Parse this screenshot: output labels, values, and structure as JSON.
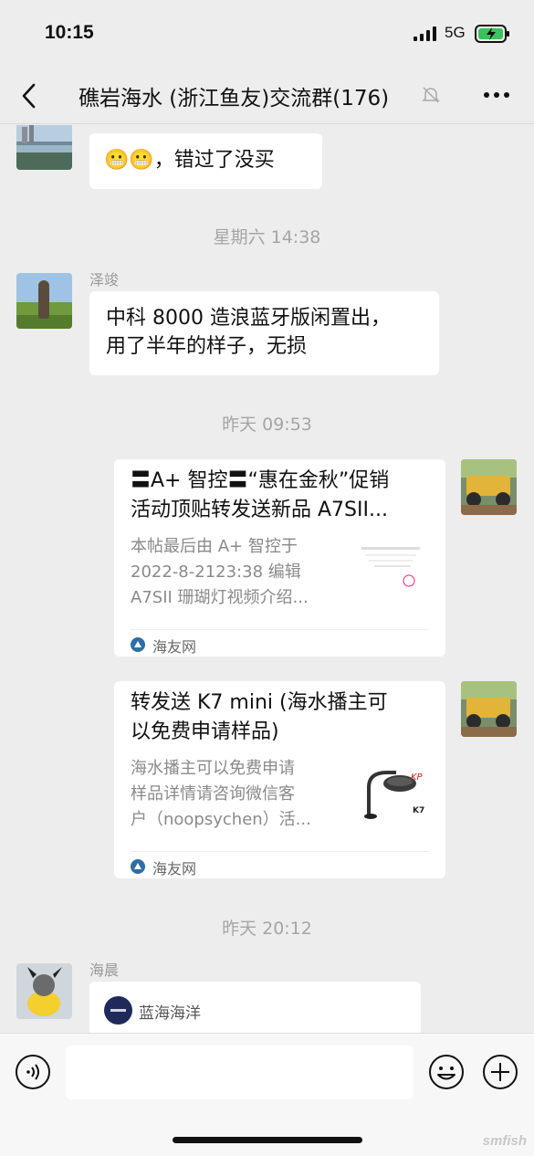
{
  "status": {
    "time": "10:15",
    "network": "5G"
  },
  "header": {
    "title": "礁岩海水 (浙江鱼友)交流群(176)"
  },
  "messages": {
    "m1": {
      "text": "😬😬，错过了没买"
    },
    "sep1": "星期六 14:38",
    "m2": {
      "sender": "泽竣",
      "line1": "中科 8000 造浪蓝牙版闲置出，",
      "line2": "用了半年的样子，无损"
    },
    "sep2": "昨天 09:53",
    "card1": {
      "title_l1": "〓A+ 智控〓“惠在金秋”促销",
      "title_l2": "活动顶贴转发送新品 A7SII...",
      "desc_l1": "本帖最后由 A+ 智控于",
      "desc_l2": "2022-8-2123:38 编辑",
      "desc_l3": "A7SII 珊瑚灯视频介绍...",
      "source": "海友网"
    },
    "card2": {
      "title_l1": "转发送 K7 mini (海水播主可",
      "title_l2": "以免费申请样品)",
      "desc_l1": "海水播主可以免费申请",
      "desc_l2": "样品详情请咨询微信客",
      "desc_l3": "户（noopsychen）活...",
      "source": "海友网",
      "thumb_label": "K7"
    },
    "sep3": "昨天 20:12",
    "m3": {
      "sender": "海晨",
      "source": "蓝海海洋"
    }
  },
  "watermark": "smfish",
  "colors": {
    "background": "#ededed",
    "bubble": "#ffffff",
    "time_gray": "#a5a5a5"
  },
  "icons": [
    "back-icon",
    "mute-icon",
    "more-icon",
    "voice-icon",
    "emoji-icon",
    "plus-icon",
    "signal-icon",
    "battery-icon"
  ]
}
